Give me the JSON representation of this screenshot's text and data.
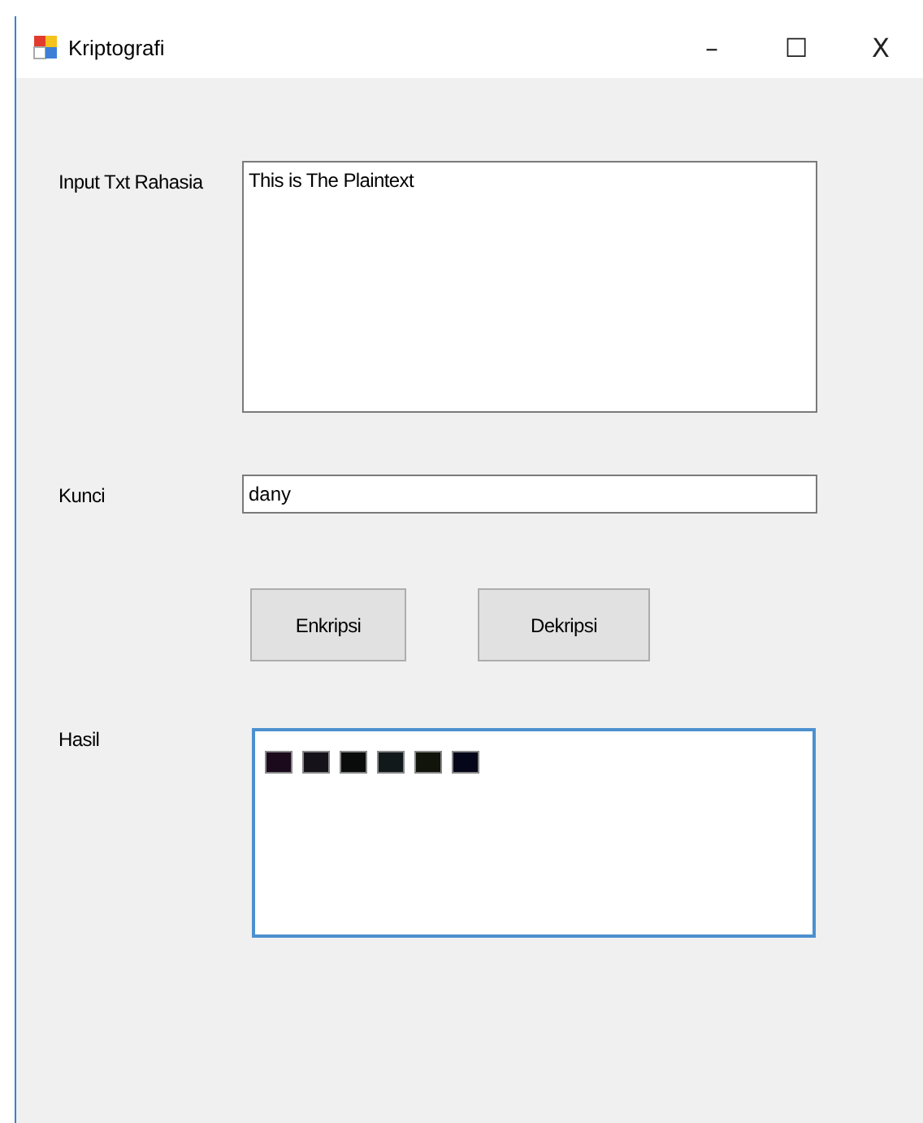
{
  "window": {
    "title": "Kriptografi",
    "controls": [
      "–",
      "☐",
      "X"
    ]
  },
  "plaintext": {
    "label": "Input Txt Rahasia",
    "value": "This is The Plaintext"
  },
  "key": {
    "label": "Kunci",
    "value": "dany"
  },
  "buttons": [
    "Enkripsi",
    "Dekripsi"
  ],
  "result": {
    "label": "Hasil",
    "focused": true,
    "glyphs": [
      {
        "color": "#1a0a1c"
      },
      {
        "color": "#16121a"
      },
      {
        "color": "#0a0c0c"
      },
      {
        "color": "#12191a"
      },
      {
        "color": "#10140a"
      },
      {
        "color": "#06061a"
      }
    ]
  }
}
